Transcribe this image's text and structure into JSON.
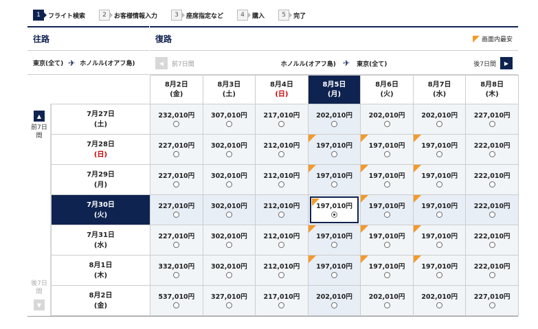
{
  "steps": [
    {
      "num": "1",
      "label": "フライト検索",
      "active": true
    },
    {
      "num": "2",
      "label": "お客様情報入力",
      "active": false
    },
    {
      "num": "3",
      "label": "座席指定など",
      "active": false
    },
    {
      "num": "4",
      "label": "購入",
      "active": false
    },
    {
      "num": "5",
      "label": "完了",
      "active": false
    }
  ],
  "outbound": {
    "title": "往路",
    "from": "東京(全て)",
    "to": "ホノルル(オアフ島)"
  },
  "return": {
    "title": "復路",
    "from": "ホノルル(オアフ島)",
    "to": "東京(全て)",
    "prev_label": "前7日間",
    "next_label": "後7日間"
  },
  "legend": {
    "label": "画面内最安",
    "color": "#f39a2a"
  },
  "side_nav": {
    "up_label_1": "前7日",
    "up_label_2": "間",
    "down_label_1": "後7日",
    "down_label_2": "間"
  },
  "colors": {
    "brand": "#0f2350",
    "cheapest_marker": "#f39a2a",
    "sunday": "#cc0000"
  },
  "return_dates": [
    {
      "date": "8月2日",
      "weekday": "(金)",
      "sunday": false,
      "selected": false
    },
    {
      "date": "8月3日",
      "weekday": "(土)",
      "sunday": false,
      "selected": false
    },
    {
      "date": "8月4日",
      "weekday": "(日)",
      "sunday": true,
      "selected": false
    },
    {
      "date": "8月5日",
      "weekday": "(月)",
      "sunday": false,
      "selected": true
    },
    {
      "date": "8月6日",
      "weekday": "(火)",
      "sunday": false,
      "selected": false
    },
    {
      "date": "8月7日",
      "weekday": "(水)",
      "sunday": false,
      "selected": false
    },
    {
      "date": "8月8日",
      "weekday": "(木)",
      "sunday": false,
      "selected": false
    }
  ],
  "rows": [
    {
      "date": "7月27日",
      "weekday": "(土)",
      "sunday": false,
      "selected": false,
      "prices": [
        "232,010円",
        "307,010円",
        "217,010円",
        "202,010円",
        "202,010円",
        "202,010円",
        "227,010円"
      ],
      "cheapest": [
        false,
        false,
        false,
        false,
        false,
        false,
        false
      ]
    },
    {
      "date": "7月28日",
      "weekday": "(日)",
      "sunday": true,
      "selected": false,
      "prices": [
        "227,010円",
        "302,010円",
        "212,010円",
        "197,010円",
        "197,010円",
        "197,010円",
        "222,010円"
      ],
      "cheapest": [
        false,
        false,
        false,
        true,
        true,
        true,
        false
      ]
    },
    {
      "date": "7月29日",
      "weekday": "(月)",
      "sunday": false,
      "selected": false,
      "prices": [
        "227,010円",
        "302,010円",
        "212,010円",
        "197,010円",
        "197,010円",
        "197,010円",
        "222,010円"
      ],
      "cheapest": [
        false,
        false,
        false,
        true,
        true,
        true,
        false
      ]
    },
    {
      "date": "7月30日",
      "weekday": "(火)",
      "sunday": false,
      "selected": true,
      "prices": [
        "227,010円",
        "302,010円",
        "212,010円",
        "197,010円",
        "197,010円",
        "197,010円",
        "222,010円"
      ],
      "cheapest": [
        false,
        false,
        false,
        true,
        true,
        true,
        false
      ]
    },
    {
      "date": "7月31日",
      "weekday": "(水)",
      "sunday": false,
      "selected": false,
      "prices": [
        "227,010円",
        "302,010円",
        "212,010円",
        "197,010円",
        "197,010円",
        "197,010円",
        "222,010円"
      ],
      "cheapest": [
        false,
        false,
        false,
        true,
        true,
        true,
        false
      ]
    },
    {
      "date": "8月1日",
      "weekday": "(木)",
      "sunday": false,
      "selected": false,
      "prices": [
        "332,010円",
        "302,010円",
        "212,010円",
        "197,010円",
        "197,010円",
        "197,010円",
        "222,010円"
      ],
      "cheapest": [
        false,
        false,
        false,
        true,
        true,
        true,
        false
      ]
    },
    {
      "date": "8月2日",
      "weekday": "(金)",
      "sunday": false,
      "selected": false,
      "prices": [
        "537,010円",
        "327,010円",
        "217,010円",
        "202,010円",
        "202,010円",
        "202,010円",
        "227,010円"
      ],
      "cheapest": [
        false,
        false,
        false,
        false,
        false,
        false,
        false
      ]
    }
  ]
}
